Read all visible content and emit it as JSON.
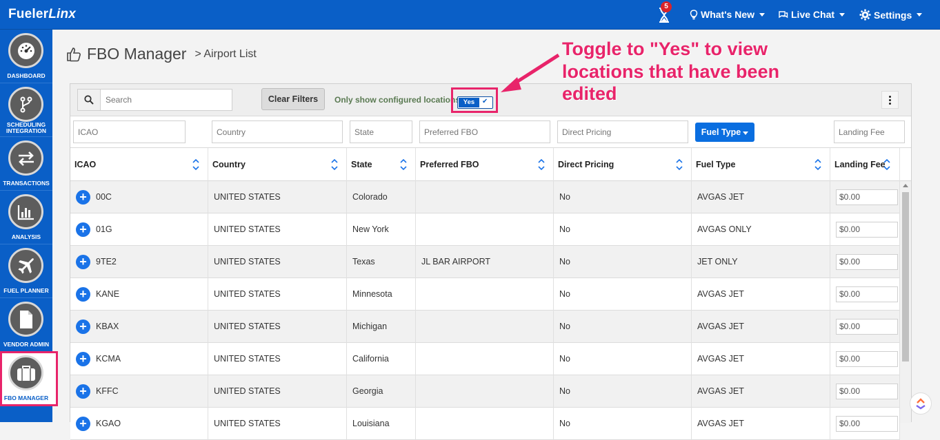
{
  "header": {
    "brand_plain": "Fueler",
    "brand_italic": "Linx",
    "notification_count": "5",
    "whats_new": "What's New",
    "live_chat": "Live Chat",
    "settings": "Settings"
  },
  "sidebar": {
    "items": [
      {
        "label": "DASHBOARD",
        "icon": "speedometer-icon"
      },
      {
        "label": "SCHEDULING INTEGRATION",
        "icon": "branch-icon"
      },
      {
        "label": "TRANSACTIONS",
        "icon": "exchange-icon"
      },
      {
        "label": "ANALYSIS",
        "icon": "bar-chart-icon"
      },
      {
        "label": "FUEL PLANNER",
        "icon": "airplane-icon"
      },
      {
        "label": "VENDOR ADMIN",
        "icon": "document-icon"
      },
      {
        "label": "FBO MANAGER",
        "icon": "briefcase-icon"
      }
    ],
    "active": "FBO MANAGER"
  },
  "page": {
    "title": "FBO Manager",
    "breadcrumb": "> Airport List"
  },
  "toolbar": {
    "search_placeholder": "Search",
    "clear_filters": "Clear Filters",
    "only_configured_label": "Only show configured locations",
    "toggle_value": "Yes"
  },
  "filters": {
    "icao_placeholder": "ICAO",
    "country_placeholder": "Country",
    "state_placeholder": "State",
    "preferred_fbo_placeholder": "Preferred FBO",
    "direct_pricing_placeholder": "Direct Pricing",
    "fuel_type_button": "Fuel Type",
    "landing_fee_placeholder": "Landing Fee"
  },
  "table": {
    "columns": [
      "ICAO",
      "Country",
      "State",
      "Preferred FBO",
      "Direct Pricing",
      "Fuel Type",
      "Landing Fee"
    ],
    "rows": [
      {
        "icao": "00C",
        "country": "UNITED STATES",
        "state": "Colorado",
        "fbo": "",
        "direct": "No",
        "fuel": "AVGAS JET",
        "fee": "$0.00"
      },
      {
        "icao": "01G",
        "country": "UNITED STATES",
        "state": "New York",
        "fbo": "",
        "direct": "No",
        "fuel": "AVGAS ONLY",
        "fee": "$0.00"
      },
      {
        "icao": "9TE2",
        "country": "UNITED STATES",
        "state": "Texas",
        "fbo": "JL BAR AIRPORT",
        "direct": "No",
        "fuel": "JET ONLY",
        "fee": "$0.00"
      },
      {
        "icao": "KANE",
        "country": "UNITED STATES",
        "state": "Minnesota",
        "fbo": "",
        "direct": "No",
        "fuel": "AVGAS JET",
        "fee": "$0.00"
      },
      {
        "icao": "KBAX",
        "country": "UNITED STATES",
        "state": "Michigan",
        "fbo": "",
        "direct": "No",
        "fuel": "AVGAS JET",
        "fee": "$0.00"
      },
      {
        "icao": "KCMA",
        "country": "UNITED STATES",
        "state": "California",
        "fbo": "",
        "direct": "No",
        "fuel": "AVGAS JET",
        "fee": "$0.00"
      },
      {
        "icao": "KFFC",
        "country": "UNITED STATES",
        "state": "Georgia",
        "fbo": "",
        "direct": "No",
        "fuel": "AVGAS JET",
        "fee": "$0.00"
      },
      {
        "icao": "KGAO",
        "country": "UNITED STATES",
        "state": "Louisiana",
        "fbo": "",
        "direct": "No",
        "fuel": "AVGAS JET",
        "fee": "$0.00"
      }
    ]
  },
  "annotation": {
    "callout_text": "Toggle to \"Yes\" to view locations that have been edited",
    "accent_color": "#e8246a"
  },
  "colors": {
    "primary": "#0a5fc7",
    "accent": "#e8246a"
  }
}
